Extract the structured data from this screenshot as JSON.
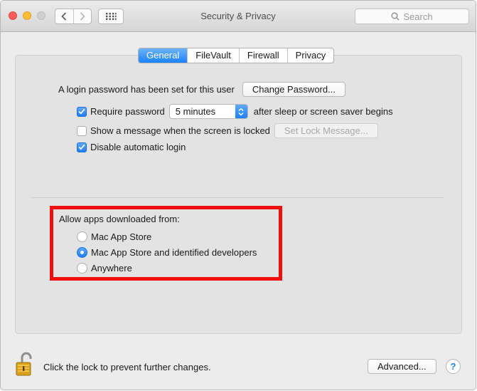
{
  "window": {
    "title": "Security & Privacy"
  },
  "search": {
    "placeholder": "Search"
  },
  "tabs": [
    {
      "label": "General",
      "active": true
    },
    {
      "label": "FileVault",
      "active": false
    },
    {
      "label": "Firewall",
      "active": false
    },
    {
      "label": "Privacy",
      "active": false
    }
  ],
  "general": {
    "login_password_text": "A login password has been set for this user",
    "change_password_label": "Change Password...",
    "require_password": {
      "checked": true,
      "label": "Require password",
      "selected_delay": "5 minutes",
      "suffix": "after sleep or screen saver begins"
    },
    "show_message": {
      "checked": false,
      "label": "Show a message when the screen is locked",
      "button_label": "Set Lock Message..."
    },
    "disable_auto_login": {
      "checked": true,
      "label": "Disable automatic login"
    }
  },
  "allow_apps": {
    "heading": "Allow apps downloaded from:",
    "options": [
      {
        "label": "Mac App Store",
        "selected": false
      },
      {
        "label": "Mac App Store and identified developers",
        "selected": true
      },
      {
        "label": "Anywhere",
        "selected": false
      }
    ]
  },
  "footer": {
    "lock_text": "Click the lock to prevent further changes.",
    "advanced_label": "Advanced...",
    "help_label": "?"
  },
  "colors": {
    "accent": "#1f7ff2",
    "highlight_box": "#ef0f0f",
    "lock_gold": "#d9a21b"
  }
}
